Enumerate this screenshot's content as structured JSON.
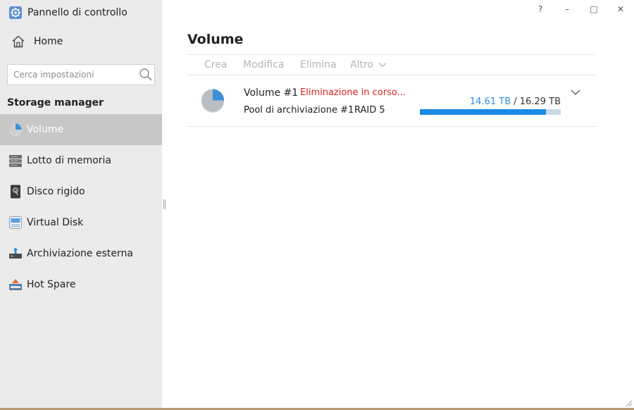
{
  "app": {
    "title": "Pannello di controllo",
    "home_label": "Home",
    "icon": "control-panel-icon"
  },
  "window_controls": {
    "help": "?",
    "minimize": "–",
    "maximize": "□",
    "close": "✕"
  },
  "search": {
    "placeholder": "Cerca impostazioni",
    "value": ""
  },
  "sidebar": {
    "section_title": "Storage manager",
    "items": [
      {
        "label": "Volume",
        "icon": "volume-pie-icon",
        "active": true
      },
      {
        "label": "Lotto di memoria",
        "icon": "storage-pool-icon",
        "active": false
      },
      {
        "label": "Disco rigido",
        "icon": "hard-disk-icon",
        "active": false
      },
      {
        "label": "Virtual Disk",
        "icon": "virtual-disk-icon",
        "active": false
      },
      {
        "label": "Archiviazione esterna",
        "icon": "external-storage-icon",
        "active": false
      },
      {
        "label": "Hot Spare",
        "icon": "hot-spare-icon",
        "active": false
      }
    ]
  },
  "main": {
    "title": "Volume",
    "toolbar": {
      "create": "Crea",
      "edit": "Modifica",
      "delete": "Elimina",
      "more": "Altro"
    },
    "volumes": [
      {
        "name": "Volume #1",
        "status": "Eliminazione in corso...",
        "pool": "Pool di archiviazione #1",
        "raid": "RAID 5",
        "used": "14.61 TB",
        "separator": " / ",
        "total": "16.29 TB",
        "usage_fraction": 0.897
      }
    ]
  },
  "colors": {
    "sidebar_bg": "#ebebeb",
    "active_bg": "#c7c7c7",
    "accent_blue": "#1a8ae6",
    "status_red": "#e02020",
    "toolbar_disabled": "#b5b5b5"
  }
}
